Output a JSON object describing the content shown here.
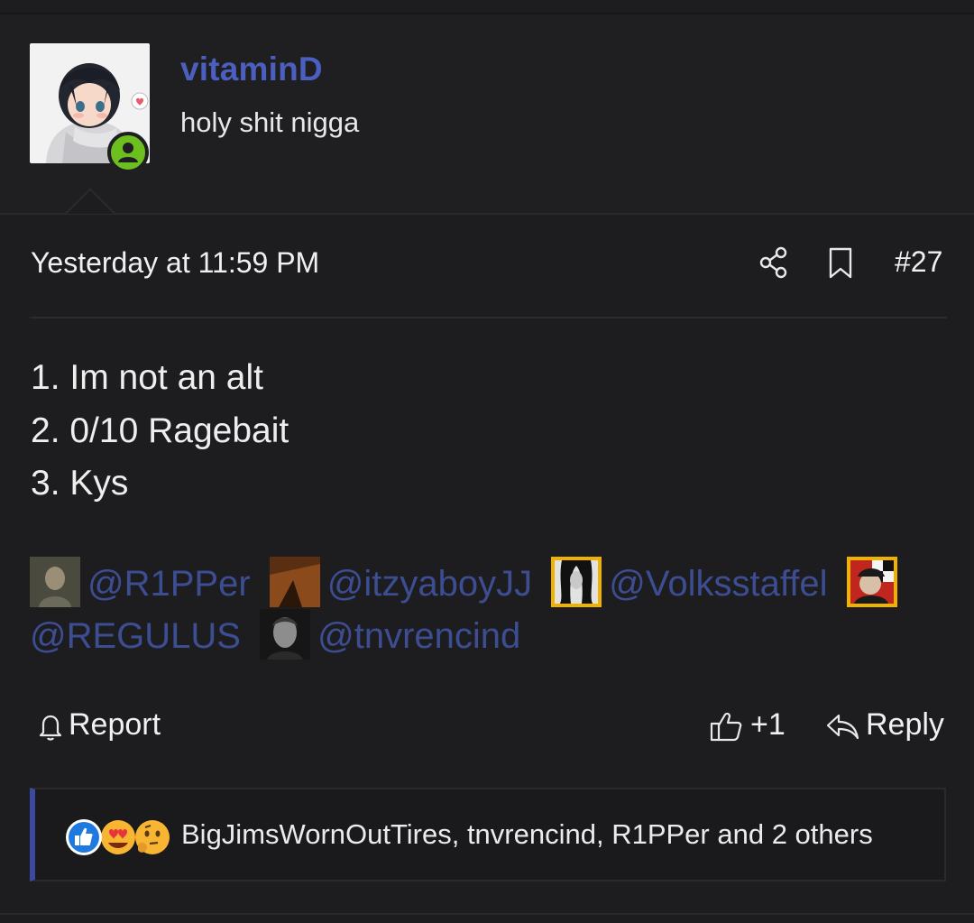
{
  "post": {
    "author": {
      "username": "vitaminD",
      "title": "holy shit nigga",
      "online": true
    },
    "timestamp": "Yesterday at 11:59 PM",
    "post_number": "#27",
    "lines": [
      "1. Im not an alt",
      "2. 0/10 Ragebait",
      "3. Kys"
    ],
    "mentions": [
      "@R1PPer",
      "@itzyaboyJJ",
      "@Volksstaffel",
      "@REGULUS",
      "@tnvrencind"
    ],
    "actions": {
      "report_label": "Report",
      "like_count": "+1",
      "reply_label": "Reply"
    },
    "reactions": {
      "icons": [
        "like-icon",
        "love-eyes-icon",
        "thinking-icon"
      ],
      "summary": "BigJimsWornOutTires, tnvrencind, R1PPer and 2 others"
    }
  },
  "colors": {
    "background": "#1d1d1f",
    "username": "#4b5fbf",
    "mention": "#3c4d92",
    "online_badge": "#6cbf1f",
    "reaction_bar_accent": "#3b4aa0"
  }
}
